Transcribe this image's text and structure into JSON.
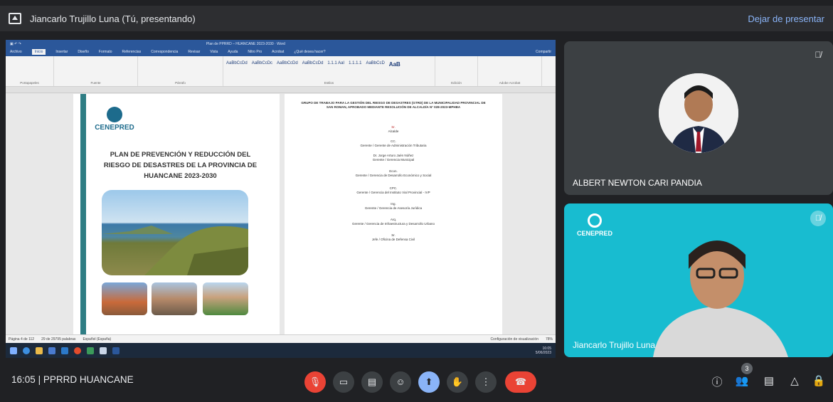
{
  "presentation_bar": {
    "presenter": "Jiancarlo Trujillo Luna (Tú, presentando)",
    "stop_label": "Dejar de presentar"
  },
  "word": {
    "window_title": "Plan de PPRRD – HUANCANE 2023-2030 · Word",
    "tabs": [
      "Archivo",
      "Inicio",
      "Insertar",
      "Diseño",
      "Formato",
      "Referencias",
      "Correspondencia",
      "Revisar",
      "Vista",
      "Ayuda",
      "Nitro Pro",
      "Acrobat",
      "¿Qué desea hacer?",
      "Compartir"
    ],
    "ribbon_groups": [
      "Portapapeles",
      "Fuente",
      "Párrafo",
      "Estilos",
      "Edición",
      "Adobe Acrobat"
    ],
    "style_samples": [
      "AaBbCcDd",
      "AaBbCcDc",
      "AaBbCcDd",
      "AaBbCcDd",
      "1.1.1 AaI",
      "1.1.1.1",
      "AaBbCcD",
      "AaB"
    ],
    "page1": {
      "logo_text": "CENEPRED",
      "title": "PLAN DE PREVENCIÓN Y REDUCCIÓN DEL RIESGO DE DESASTRES DE LA PROVINCIA DE HUANCANE 2023-2030"
    },
    "page2": {
      "heading": "GRUPO DE TRABAJO PARA LA GESTIÓN DEL RIESGO DE DESASTRES (GTRD) DE LA MUNICIPALIDAD PROVINCIAL DE SAN ROMAN, APROBADO MEDIANTE RESOLUCIÓN DE ALCALDÍA N° 028-2023-MPHBA",
      "entries": [
        "Sr.",
        "Alcalde",
        "CC.",
        "Gerente / Gerente de Administración Tributaria",
        "Dr. Jorge Arturo Jaén Núñez",
        "Gerente / Gerencia Municipal",
        "Econ.",
        "Gerente / Gerencia de Desarrollo Económico y Social",
        "CPC.",
        "Gerente / Gerencia del Instituto Vial Provincial - IVP",
        "Ing.",
        "Gerente / Gerencia de Asesoría Jurídica",
        "Arq.",
        "Gerente / Gerencia de Infraestructura y Desarrollo Urbano",
        "Sr.",
        "Jefe / Oficina de Defensa Civil"
      ]
    },
    "status": {
      "page": "Página 4 de 112",
      "words": "29 de 29795 palabras",
      "language": "Español (España)",
      "display_settings": "Configuración de visualización",
      "zoom": "78%"
    },
    "taskbar_clock": {
      "time": "16:05",
      "date": "5/06/2023"
    }
  },
  "participants": [
    {
      "name": "ALBERT NEWTON CARI PANDIA"
    },
    {
      "name": "Jiancarlo Trujillo Luna",
      "camera_logo": "CENEPRED"
    }
  ],
  "bottom_bar": {
    "time": "16:05",
    "meeting_name": "PPRRD HUANCANE",
    "participant_count": "3"
  },
  "colors": {
    "word_blue": "#2b579a",
    "end_call_red": "#ea4335",
    "accent_blue": "#8ab4f8",
    "bar_teal": "#2e7d84"
  }
}
